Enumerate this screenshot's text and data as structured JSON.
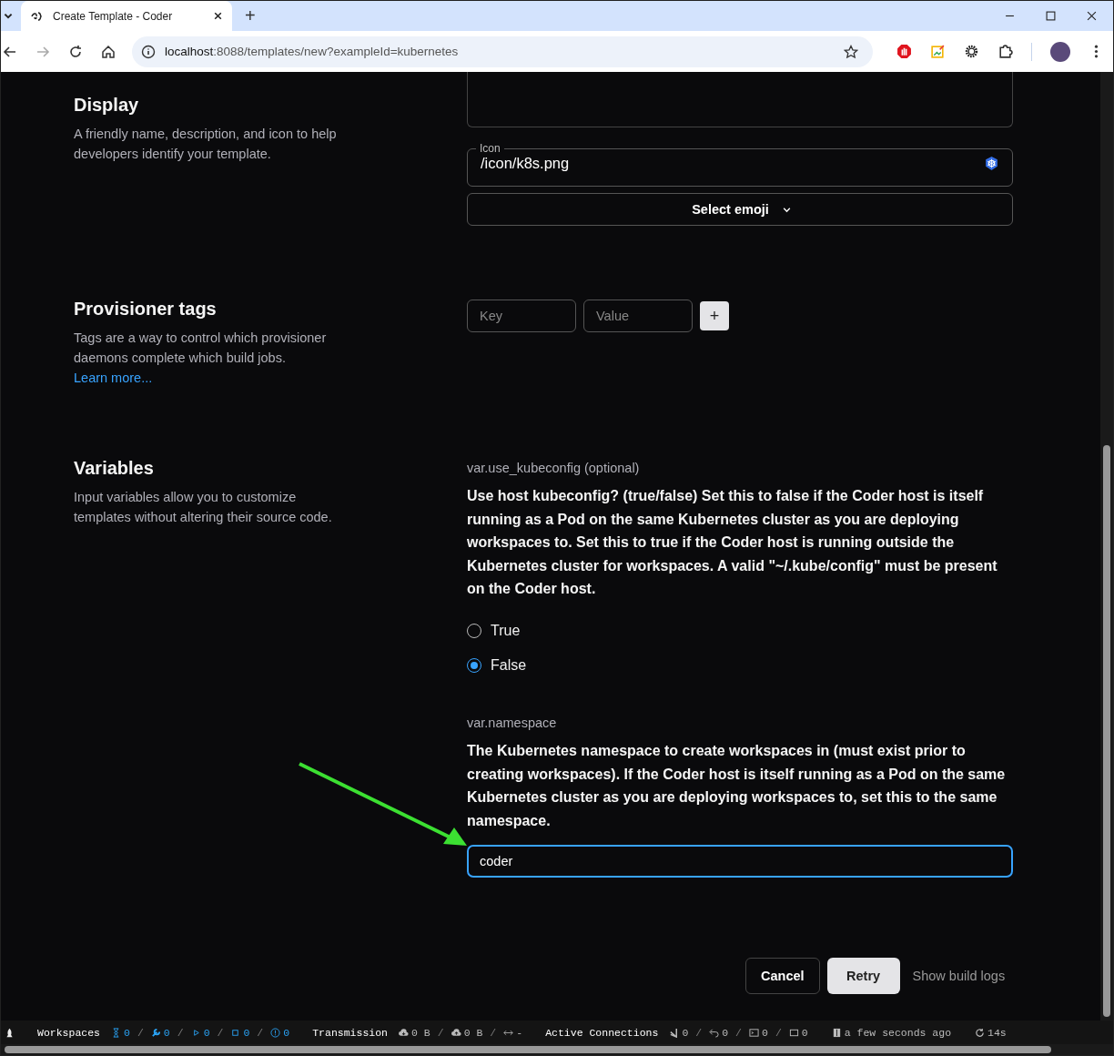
{
  "browser": {
    "tab_title": "Create Template - Coder",
    "new_tab": "+",
    "url_host": "localhost",
    "url_rest": ":8088/templates/new?exampleId=kubernetes"
  },
  "display": {
    "title": "Display",
    "description": "A friendly name, description, and icon to help developers identify your template.",
    "icon_field": {
      "label": "Icon",
      "value": "/icon/k8s.png"
    },
    "emoji_button": "Select emoji"
  },
  "provisioner_tags": {
    "title": "Provisioner tags",
    "description": "Tags are a way to control which provisioner daemons complete which build jobs.",
    "link": "Learn more...",
    "key": {
      "placeholder": "Key"
    },
    "value": {
      "placeholder": "Value"
    },
    "add_button": "+"
  },
  "variables": {
    "title": "Variables",
    "description": "Input variables allow you to customize templates without altering their source code.",
    "items": [
      {
        "kind": "radio",
        "name": "var.use_kubeconfig (optional)",
        "description": "Use host kubeconfig? (true/false) Set this to false if the Coder host is itself running as a Pod on the same Kubernetes cluster as you are deploying workspaces to. Set this to true if the Coder host is running outside the Kubernetes cluster for workspaces. A valid \"~/.kube/config\" must be present on the Coder host.",
        "options": [
          {
            "label": "True",
            "selected": false
          },
          {
            "label": "False",
            "selected": true
          }
        ]
      },
      {
        "kind": "text",
        "name": "var.namespace",
        "description": "The Kubernetes namespace to create workspaces in (must exist prior to creating workspaces). If the Coder host is itself running as a Pod on the same Kubernetes cluster as you are deploying workspaces to, set this to the same namespace.",
        "value": "coder"
      }
    ]
  },
  "actions": {
    "cancel": "Cancel",
    "retry": "Retry",
    "logs": "Show build logs"
  },
  "status_bar": {
    "groups": [
      {
        "label": "Workspaces",
        "items": [
          {
            "kind": "stat",
            "text": "0"
          },
          {
            "kind": "sep",
            "text": "/"
          },
          {
            "kind": "stat",
            "text": "0"
          },
          {
            "kind": "sep",
            "text": "/"
          },
          {
            "kind": "stat",
            "text": "0"
          },
          {
            "kind": "sep",
            "text": "/"
          },
          {
            "kind": "stat",
            "text": "0"
          },
          {
            "kind": "sep",
            "text": "/"
          },
          {
            "kind": "stat",
            "text": "0"
          }
        ]
      },
      {
        "label": "Transmission",
        "items": [
          {
            "kind": "stat",
            "text": "0 B"
          },
          {
            "kind": "sep",
            "text": "/"
          },
          {
            "kind": "stat",
            "text": "0 B"
          },
          {
            "kind": "sep",
            "text": "/"
          },
          {
            "kind": "stat",
            "text": "-"
          }
        ]
      },
      {
        "label": "Active Connections",
        "items": [
          {
            "kind": "stat",
            "text": "0"
          },
          {
            "kind": "sep",
            "text": "/"
          },
          {
            "kind": "stat",
            "text": "0"
          },
          {
            "kind": "sep",
            "text": "/"
          },
          {
            "kind": "stat",
            "text": "0"
          },
          {
            "kind": "sep",
            "text": "/"
          },
          {
            "kind": "stat",
            "text": "0"
          }
        ]
      },
      {
        "items": [
          {
            "kind": "stat",
            "text": "a few seconds ago"
          }
        ]
      },
      {
        "items": [
          {
            "kind": "stat",
            "text": "14s"
          }
        ]
      }
    ]
  }
}
